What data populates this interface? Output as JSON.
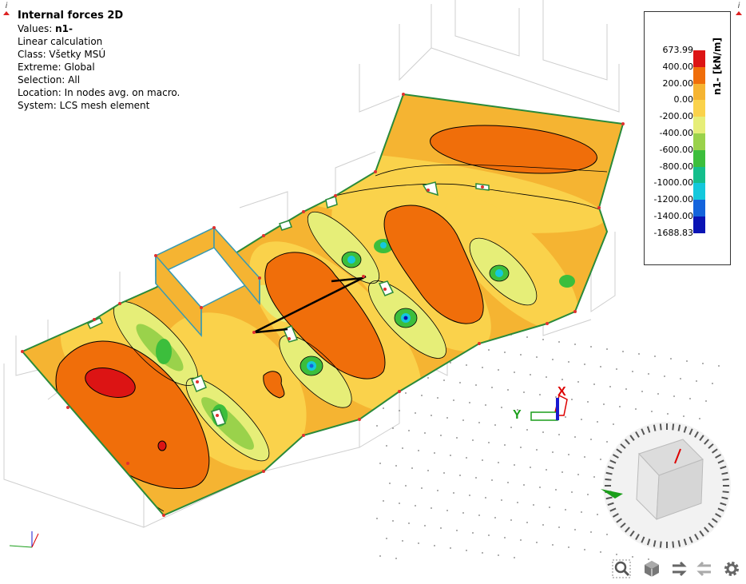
{
  "info": {
    "title": "Internal forces 2D",
    "values_label": "Values:",
    "values_value": "n1-",
    "calc": "Linear calculation",
    "class": "Class: Všetky MSÚ",
    "extreme": "Extreme: Global",
    "selection": "Selection: All",
    "location": "Location: In nodes avg. on macro.",
    "system": "System: LCS mesh element"
  },
  "legend": {
    "unit": "n1- [kN/m]",
    "labels": [
      "673.99",
      "400.00",
      "200.00",
      "0.00",
      "-200.00",
      "-400.00",
      "-600.00",
      "-800.00",
      "-1000.00",
      "-1200.00",
      "-1400.00",
      "-1688.83"
    ],
    "colors": [
      "#dc1414",
      "#f06e0a",
      "#f5b432",
      "#fad24b",
      "#e6ee78",
      "#9ad24b",
      "#3cbe3c",
      "#14be8c",
      "#14c8dc",
      "#1464dc",
      "#0a14b4"
    ]
  },
  "axes": {
    "x": "X",
    "y": "Y"
  },
  "colors": {
    "slab_edge": "#2a8a3a",
    "node": "#e03030",
    "background": "#ffffff"
  },
  "toolbar": {
    "zoom": "magnifier-icon",
    "view": "cube-icon",
    "undo": "rotate-back-icon",
    "redo": "rotate-forward-icon",
    "settings": "gear-icon"
  }
}
